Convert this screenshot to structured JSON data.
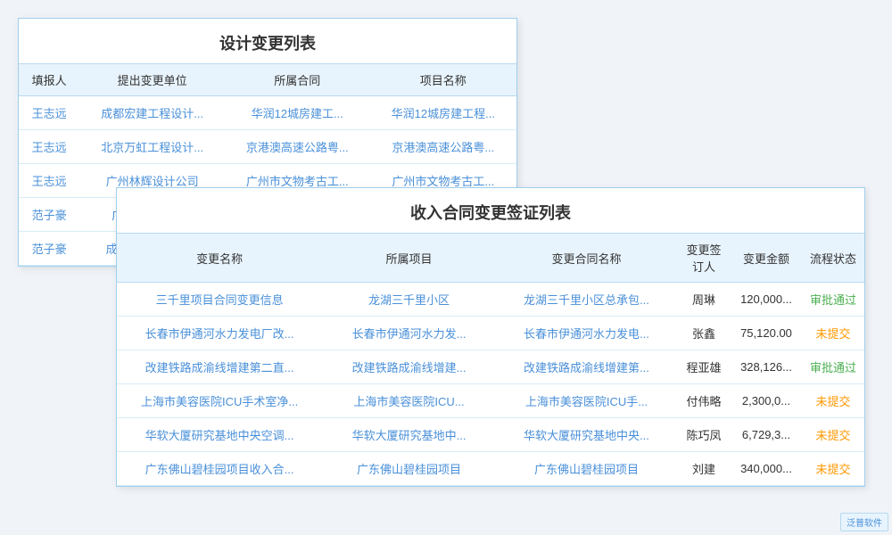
{
  "table1": {
    "title": "设计变更列表",
    "headers": [
      "填报人",
      "提出变更单位",
      "所属合同",
      "项目名称"
    ],
    "rows": [
      [
        "王志远",
        "成都宏建工程设计...",
        "华润12城房建工...",
        "华润12城房建工程..."
      ],
      [
        "王志远",
        "北京万虹工程设计...",
        "京港澳高速公路粤...",
        "京港澳高速公路粤..."
      ],
      [
        "王志远",
        "广州林辉设计公司",
        "广州市文物考古工...",
        "广州市文物考古工..."
      ],
      [
        "范子豪",
        "广东鸿达鑫工程",
        "",
        ""
      ],
      [
        "范子豪",
        "成都浩海工程设计",
        "",
        ""
      ]
    ]
  },
  "table2": {
    "title": "收入合同变更签证列表",
    "headers": [
      "变更名称",
      "所属项目",
      "变更合同名称",
      "变更签订人",
      "变更金额",
      "流程状态"
    ],
    "rows": [
      [
        "三千里项目合同变更信息",
        "龙湖三千里小区",
        "龙湖三千里小区总承包...",
        "周琳",
        "120,000...",
        "审批通过"
      ],
      [
        "长春市伊通河水力发电厂改...",
        "长春市伊通河水力发...",
        "长春市伊通河水力发电...",
        "张鑫",
        "75,120.00",
        "未提交"
      ],
      [
        "改建铁路成渝线增建第二直...",
        "改建铁路成渝线增建...",
        "改建铁路成渝线增建第...",
        "程亚雄",
        "328,126...",
        "审批通过"
      ],
      [
        "上海市美容医院ICU手术室净...",
        "上海市美容医院ICU...",
        "上海市美容医院ICU手...",
        "付伟略",
        "2,300,0...",
        "未提交"
      ],
      [
        "华软大厦研究基地中央空调...",
        "华软大厦研究基地中...",
        "华软大厦研究基地中央...",
        "陈巧凤",
        "6,729,3...",
        "未提交"
      ],
      [
        "广东佛山碧桂园项目收入合...",
        "广东佛山碧桂园项目",
        "广东佛山碧桂园项目",
        "刘建",
        "340,000...",
        "未提交"
      ]
    ]
  },
  "watermark": "泛普软件",
  "watermark_url": "www.fanpusoft.com"
}
